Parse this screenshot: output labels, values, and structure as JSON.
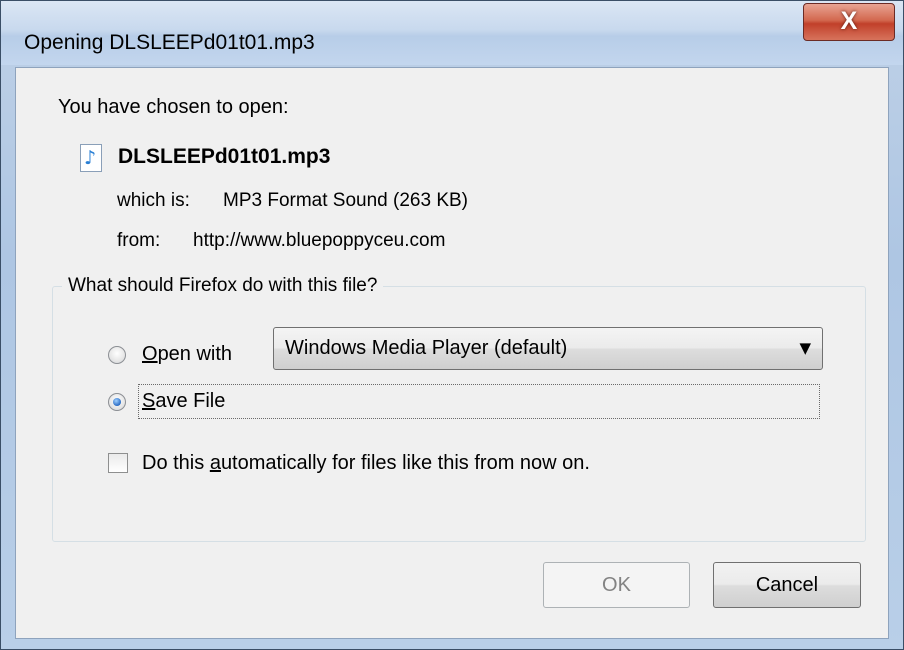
{
  "window": {
    "title": "Opening DLSLEEPd01t01.mp3",
    "close_label": "X"
  },
  "dialog": {
    "chosen_text": "You have chosen to open:",
    "file_icon": "mp3-file-icon",
    "filename": "DLSLEEPd01t01.mp3",
    "which_label": "which is:",
    "which_value": "MP3 Format Sound (263 KB)",
    "from_label": "from:",
    "from_value": "http://www.bluepoppyceu.com"
  },
  "choice": {
    "question": "What should Firefox do with this file?",
    "open_with": {
      "prefix": "",
      "accel": "O",
      "rest": "pen with",
      "selected": false
    },
    "app_select": {
      "value": "Windows Media Player (default)"
    },
    "save_file": {
      "accel": "S",
      "rest": "ave File",
      "selected": true
    },
    "auto": {
      "prefix": "Do this ",
      "accel": "a",
      "rest": "utomatically for files like this from now on.",
      "checked": false
    }
  },
  "buttons": {
    "ok": "OK",
    "cancel": "Cancel",
    "ok_enabled": false
  },
  "colors": {
    "frame": "#bccfe6",
    "client": "#f0f0f0",
    "close": "#c1402a",
    "radio_dot": "#2a6bc4",
    "disabled_text": "#838383"
  }
}
